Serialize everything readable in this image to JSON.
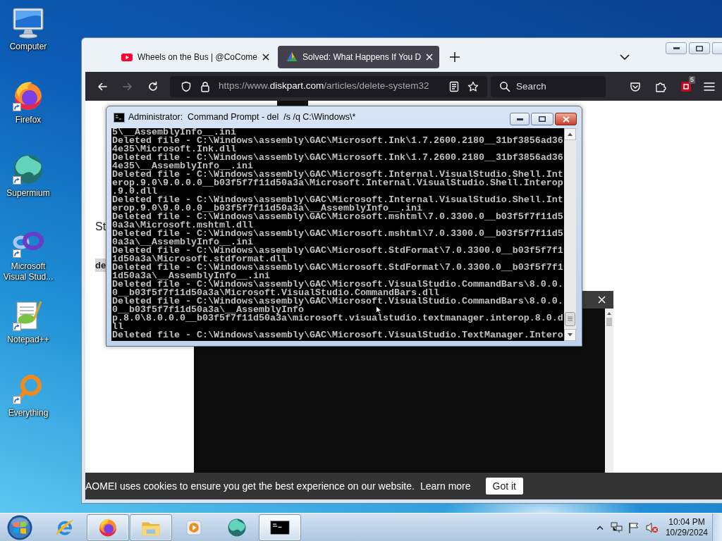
{
  "desktop": {
    "icons": [
      {
        "label": "Computer",
        "kind": "computer",
        "shortcut": false
      },
      {
        "label": "Firefox",
        "kind": "firefox",
        "shortcut": true
      },
      {
        "label": "Supermium",
        "kind": "supermium",
        "shortcut": true
      },
      {
        "label": "Microsoft Visual Stud...",
        "kind": "visualstudio",
        "shortcut": true
      },
      {
        "label": "Notepad++",
        "kind": "notepadpp",
        "shortcut": true
      },
      {
        "label": "Everything",
        "kind": "everything",
        "shortcut": true
      }
    ]
  },
  "browser": {
    "tabs": [
      {
        "title": "Wheels on the Bus | @CoCome",
        "kind": "youtube",
        "selected": false
      },
      {
        "title": "Solved: What Happens If You D",
        "kind": "aomei",
        "selected": true
      }
    ],
    "nav_buttons": [
      {
        "kind": "back",
        "disabled": false
      },
      {
        "kind": "forward",
        "disabled": true
      },
      {
        "kind": "reload",
        "disabled": false
      }
    ],
    "url": {
      "prefix": "https://www.",
      "domain": "diskpart.com",
      "path": "/articles/delete-system32"
    },
    "search": {
      "placeholder": "Search"
    },
    "extension_badge": "5",
    "page": {
      "texts": [
        {
          "kind": "heading",
          "text": "St"
        },
        {
          "kind": "code",
          "text": "de"
        }
      ]
    },
    "cookie_bar": {
      "message": "AOMEI uses cookies to ensure you get the best experience on our website.",
      "link": "Learn more",
      "button": "Got it"
    }
  },
  "console": {
    "title": "Administrator:  Command Prompt - del  /s /q C:\\Windows\\*",
    "lines": [
      "5\\__AssemblyInfo__.ini",
      "Deleted file - C:\\Windows\\assembly\\GAC\\Microsoft.Ink\\1.7.2600.2180__31bf3856ad36",
      "4e35\\Microsoft.Ink.dll",
      "Deleted file - C:\\Windows\\assembly\\GAC\\Microsoft.Ink\\1.7.2600.2180__31bf3856ad36",
      "4e35\\__AssemblyInfo__.ini",
      "Deleted file - C:\\Windows\\assembly\\GAC\\Microsoft.Internal.VisualStudio.Shell.Int",
      "erop.9.0\\9.0.0.0__b03f5f7f11d50a3a\\Microsoft.Internal.VisualStudio.Shell.Interop",
      ".9.0.dll",
      "Deleted file - C:\\Windows\\assembly\\GAC\\Microsoft.Internal.VisualStudio.Shell.Int",
      "erop.9.0\\9.0.0.0__b03f5f7f11d50a3a\\__AssemblyInfo__.ini",
      "Deleted file - C:\\Windows\\assembly\\GAC\\Microsoft.mshtml\\7.0.3300.0__b03f5f7f11d5",
      "0a3a\\Microsoft.mshtml.dll",
      "Deleted file - C:\\Windows\\assembly\\GAC\\Microsoft.mshtml\\7.0.3300.0__b03f5f7f11d5",
      "0a3a\\__AssemblyInfo__.ini",
      "Deleted file - C:\\Windows\\assembly\\GAC\\Microsoft.StdFormat\\7.0.3300.0__b03f5f7f1",
      "1d50a3a\\Microsoft.stdformat.dll",
      "Deleted file - C:\\Windows\\assembly\\GAC\\Microsoft.StdFormat\\7.0.3300.0__b03f5f7f1",
      "1d50a3a\\__AssemblyInfo__.ini",
      "Deleted file - C:\\Windows\\assembly\\GAC\\Microsoft.VisualStudio.CommandBars\\8.0.0.",
      "0__b03f5f7f11d50a3a\\Microsoft.VisualStudio.CommandBars.dll",
      "Deleted file - C:\\Windows\\assembly\\GAC\\Microsoft.VisualStudio.CommandBars\\8.0.0.",
      "0__b03f5f7f11d50a3a\\__AssemblyInfo",
      "p.8.0\\8.0.0.0__b03f5f7f11d50a3a\\microsoft.visualstudio.textmanager.interop.8.0.d",
      "ll",
      "Deleted file - C:\\Windows\\assembly\\GAC\\Microsoft.VisualStudio.TextManager.Intero"
    ]
  },
  "taskbar": {
    "items": [
      {
        "kind": "ie",
        "running": false,
        "selected": false
      },
      {
        "kind": "firefox",
        "running": true,
        "selected": false
      },
      {
        "kind": "explorer",
        "running": true,
        "selected": false
      },
      {
        "kind": "media",
        "running": false,
        "selected": false
      },
      {
        "kind": "supermium",
        "running": false,
        "selected": false
      },
      {
        "kind": "cmd",
        "running": true,
        "selected": true
      }
    ],
    "clock": {
      "time": "10:04 PM",
      "date": "10/29/2024"
    }
  }
}
